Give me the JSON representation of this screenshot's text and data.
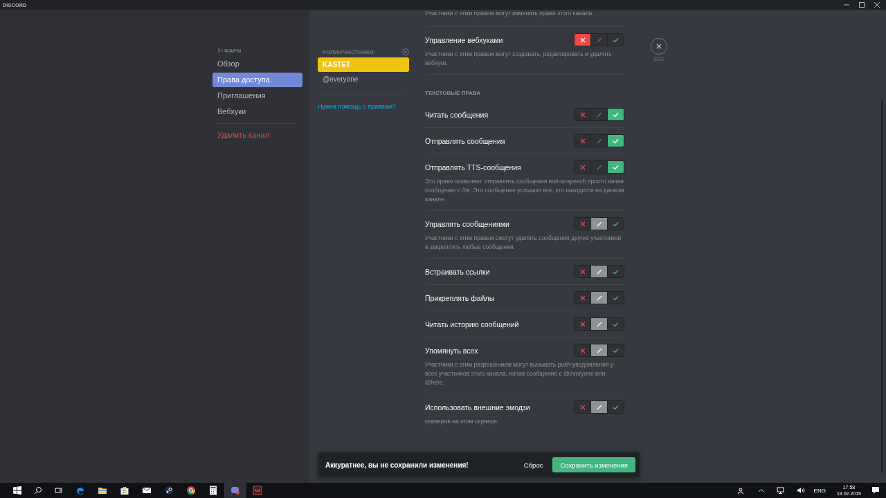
{
  "window": {
    "title": "DISCORD"
  },
  "sidebar": {
    "heading": "ФАРМ",
    "items": [
      {
        "label": "Обзор",
        "selected": false,
        "kind": "normal"
      },
      {
        "label": "Права доступа",
        "selected": true,
        "kind": "normal"
      },
      {
        "label": "Приглашения",
        "selected": false,
        "kind": "normal"
      },
      {
        "label": "Вебхуки",
        "selected": false,
        "kind": "normal"
      },
      {
        "label": "Удалить канал",
        "selected": false,
        "kind": "danger"
      }
    ]
  },
  "roles": {
    "heading": "РОЛИ/УЧАСТНИКИ",
    "items": [
      {
        "label": "KASTET",
        "selected": true,
        "color": "#f1c40f"
      },
      {
        "label": "@everyone",
        "selected": false
      }
    ],
    "help_link": "Нужна помощь с правами?"
  },
  "permissions": [
    {
      "kind": "note",
      "description": "Участники с этим правом могут изменять права этого канала."
    },
    {
      "kind": "permission",
      "title": "Управление вебхуками",
      "toggle": [
        {
          "kind": "deny",
          "selected": true
        },
        {
          "kind": "neutral",
          "selected": false
        },
        {
          "kind": "allow",
          "selected": false
        }
      ],
      "description": "Участники с этим правом могут создавать, редактировать и удалять вебхуки."
    },
    {
      "kind": "section",
      "title": "ТЕКСТОВЫЕ ПРАВА"
    },
    {
      "kind": "permission",
      "title": "Читать сообщения",
      "toggle": [
        {
          "kind": "deny",
          "selected": false
        },
        {
          "kind": "neutral",
          "selected": false
        },
        {
          "kind": "allow",
          "selected": true
        }
      ]
    },
    {
      "kind": "permission",
      "title": "Отправлять сообщения",
      "toggle": [
        {
          "kind": "deny",
          "selected": false
        },
        {
          "kind": "neutral",
          "selected": false
        },
        {
          "kind": "allow",
          "selected": true
        }
      ]
    },
    {
      "kind": "permission",
      "title": "Отправлять TTS-сообщения",
      "toggle": [
        {
          "kind": "deny",
          "selected": false
        },
        {
          "kind": "neutral",
          "selected": false
        },
        {
          "kind": "allow",
          "selected": true
        }
      ],
      "description": "Это право позволяет отправлять сообщения text-to-speech просто начав сообщение с /tts. Это сообщение услышат все, кто находится на данном канале."
    },
    {
      "kind": "permission",
      "title": "Управлять сообщениями",
      "toggle": [
        {
          "kind": "deny",
          "selected": false
        },
        {
          "kind": "neutral",
          "selected": true
        },
        {
          "kind": "allow",
          "selected": false
        }
      ],
      "description": "Участники с этим правом смогут удалять сообщения других участников и закреплять любые сообщения."
    },
    {
      "kind": "permission",
      "title": "Встраивать ссылки",
      "toggle": [
        {
          "kind": "deny",
          "selected": false
        },
        {
          "kind": "neutral",
          "selected": true
        },
        {
          "kind": "allow",
          "selected": false
        }
      ]
    },
    {
      "kind": "permission",
      "title": "Прикреплять файлы",
      "toggle": [
        {
          "kind": "deny",
          "selected": false
        },
        {
          "kind": "neutral",
          "selected": true
        },
        {
          "kind": "allow",
          "selected": false
        }
      ]
    },
    {
      "kind": "permission",
      "title": "Читать историю сообщений",
      "toggle": [
        {
          "kind": "deny",
          "selected": false
        },
        {
          "kind": "neutral",
          "selected": true
        },
        {
          "kind": "allow",
          "selected": false
        }
      ]
    },
    {
      "kind": "permission",
      "title": "Упомянуть всех",
      "toggle": [
        {
          "kind": "deny",
          "selected": false
        },
        {
          "kind": "neutral",
          "selected": true
        },
        {
          "kind": "allow",
          "selected": false
        }
      ],
      "description": "Участники с этим разрешением могут вызывать push-уведомления у всех участников этого канала, начав сообщение с @everyone или @here."
    },
    {
      "kind": "permission",
      "title": "Использовать внешние эмодзи",
      "toggle": [
        {
          "kind": "deny",
          "selected": false
        },
        {
          "kind": "neutral",
          "selected": true
        },
        {
          "kind": "allow",
          "selected": false
        }
      ],
      "description": "серверов на этом сервере."
    }
  ],
  "close": {
    "label": "ESC"
  },
  "notice": {
    "text": "Аккуратнее, вы не сохранили изменения!",
    "reset": "Сброс",
    "save": "Сохранить изменения"
  },
  "taskbar": {
    "apps": [
      {
        "kind": "edge",
        "selected": false
      },
      {
        "kind": "folder",
        "selected": false
      },
      {
        "kind": "store",
        "selected": false
      },
      {
        "kind": "mail",
        "selected": false
      },
      {
        "kind": "steam",
        "selected": false
      },
      {
        "kind": "chrome",
        "selected": false
      },
      {
        "kind": "calculator",
        "selected": false
      },
      {
        "kind": "discord",
        "selected": true
      },
      {
        "kind": "app",
        "selected": false
      }
    ],
    "language": "ENG",
    "time": "17:58",
    "date": "19.02.2019"
  }
}
